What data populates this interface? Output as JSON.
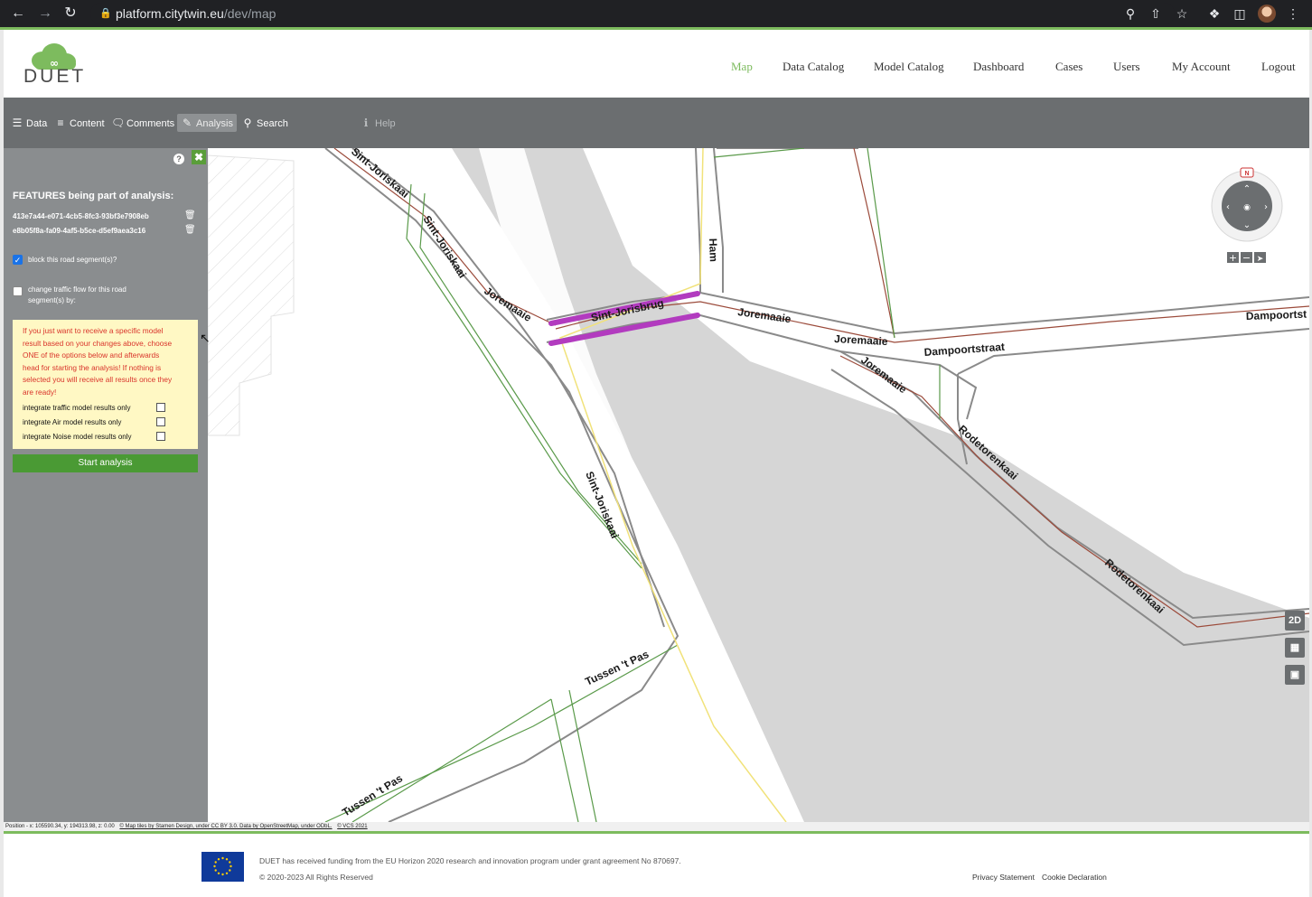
{
  "browser": {
    "url_host": "platform.citytwin.eu",
    "url_path": "/dev/map"
  },
  "app": {
    "logo_text": "DUET",
    "nav": [
      "Map",
      "Data Catalog",
      "Model Catalog",
      "Dashboard",
      "Cases",
      "Users",
      "My Account",
      "Logout"
    ],
    "active_nav": "Map"
  },
  "toolbar": {
    "data": "Data",
    "content": "Content",
    "comments": "Comments",
    "analysis": "Analysis",
    "search": "Search",
    "help": "Help"
  },
  "sidebar": {
    "features_title": "FEATURES being part of analysis:",
    "features": [
      "413e7a44-e071-4cb5-8fc3-93bf3e7908eb",
      "e8b05f8a-fa09-4af5-b5ce-d5ef9aea3c16"
    ],
    "block_label": "block this road segment(s)?",
    "block_checked": true,
    "change_label_1": "change traffic flow for this road",
    "change_label_2": "segment(s) by:",
    "change_checked": false,
    "notice_lines": [
      "If you just want to receive a specific model",
      "result based on your changes above, choose",
      "ONE of the options below and afterwards",
      "head for starting the analysis! If nothing is",
      "selected you will receive all results once they",
      "are ready!"
    ],
    "options": [
      "integrate traffic model results only",
      "integrate Air model results only",
      "integrate Noise model results only"
    ],
    "start_button": "Start analysis"
  },
  "map": {
    "labels": {
      "sint_joriskaai_1": "Sint-Joriskaai",
      "sint_joriskaai_2": "Sint-Joriskaai",
      "sint_joriskaai_3": "Sint-Joriskaai",
      "joremaaie_1": "Joremaaie",
      "sint_jorisbrug": "Sint-Jorisbrug",
      "ham": "Ham",
      "joremaaie_2": "Joremaaie",
      "joremaaie_3": "Joremaaie",
      "joremaaie_4": "Joremaaie",
      "dampoortstraat_1": "Dampoortstraat",
      "dampoortstraat_2": "Dampoortst",
      "rodetorenkaai_1": "Rodetorenkaai",
      "rodetorenkaai_2": "Rodetorenkaai",
      "tussen_pas_1": "Tussen 't Pas",
      "tussen_pas_2": "Tussen 't Pas"
    },
    "compass_n": "N",
    "controls": {
      "view2d": "2D"
    },
    "attribution": {
      "position": "Position - x: 105590.34, y: 194313.98, z: 0.00",
      "tiles": "© Map tiles by Stamen Design, under CC BY 3.0. Data by OpenStreetMap, under ODbL.",
      "vcs": "© VCS 2021"
    },
    "colors": {
      "highlight": "#b23bbf",
      "road_red": "#9b4a3a",
      "road_green": "#5a9a4a",
      "water": "#d6d6d6"
    }
  },
  "footer": {
    "funding": "DUET has received funding from the EU Horizon 2020 research and innovation program under grant agreement No 870697.",
    "copyright": "© 2020-2023 All Rights Reserved",
    "privacy": "Privacy Statement",
    "cookie": "Cookie Declaration"
  }
}
